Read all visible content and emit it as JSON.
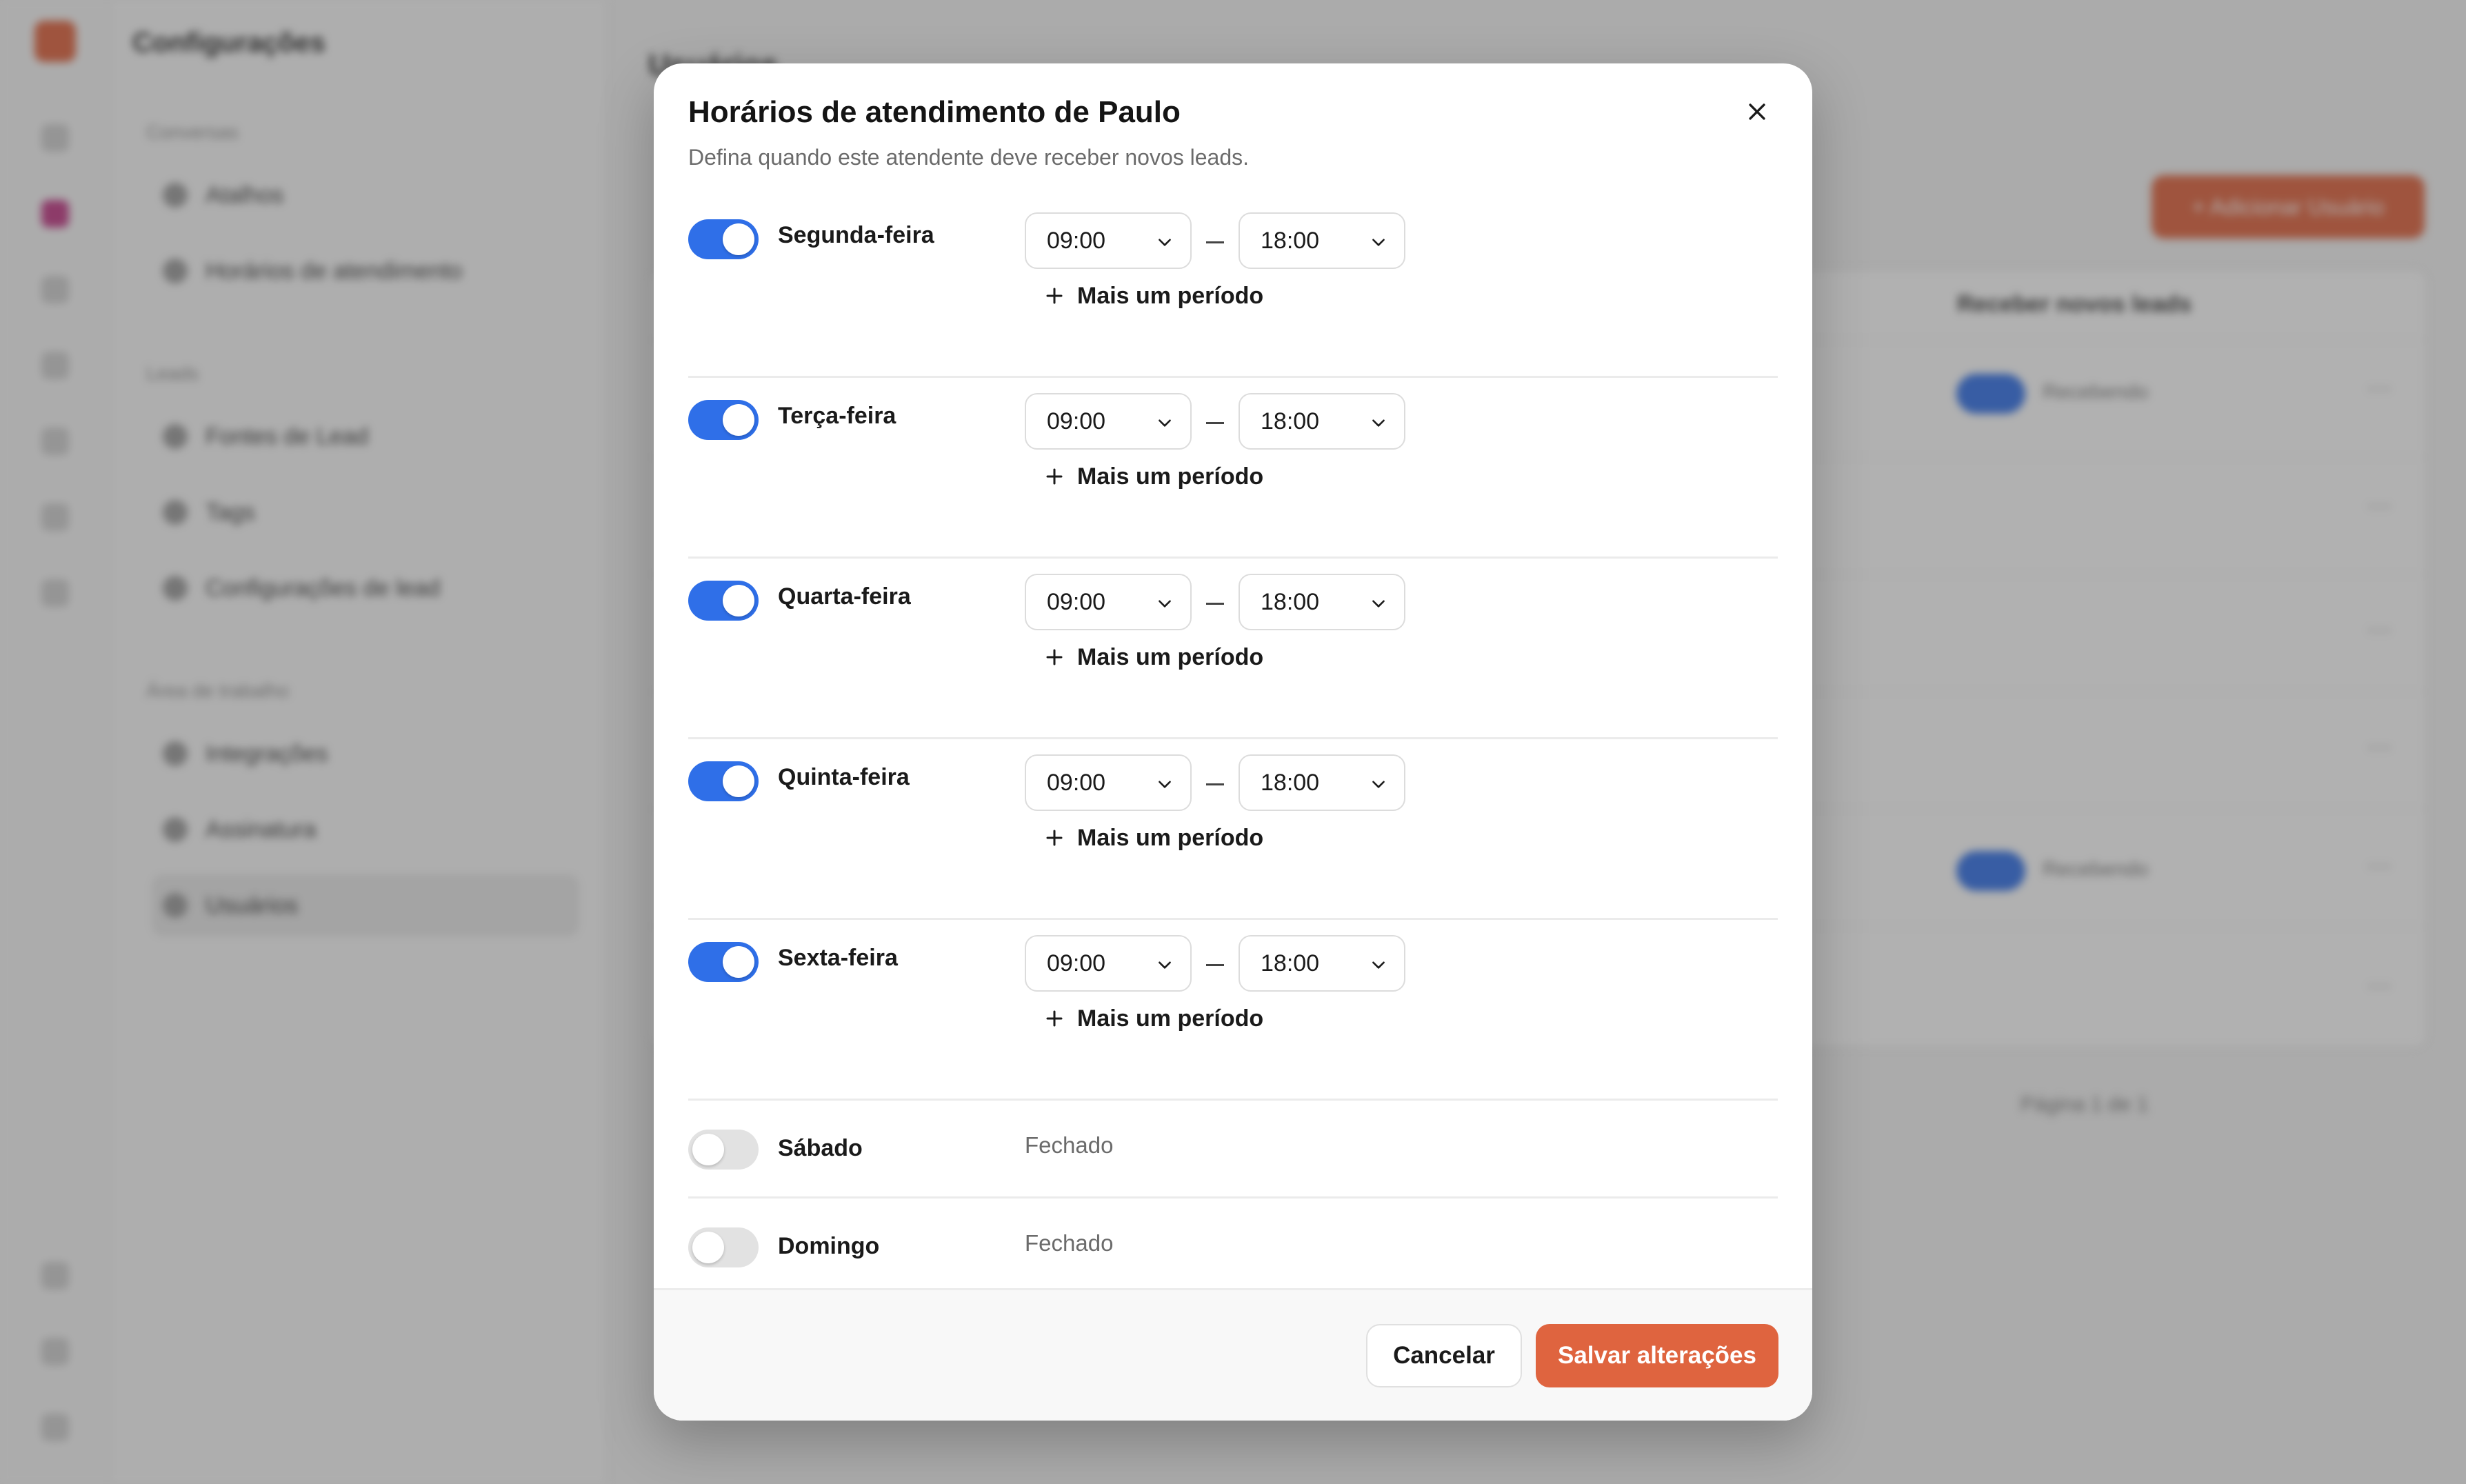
{
  "background": {
    "settings_title": "Configurações",
    "groups": [
      "Conversas",
      "Leads",
      "Área de trabalho"
    ],
    "nav_items": [
      "Atalhos",
      "Horários de atendimento",
      "Fontes de Lead",
      "Tags",
      "Configurações de lead",
      "Integrações",
      "Assinatura",
      "Usuários"
    ],
    "page_title": "Usuários",
    "add_user_label": "+ Adicionar Usuário",
    "column_header": "Receber novos leads",
    "receiving_label": "Recebendo",
    "pager_label": "Página 1 de 1"
  },
  "dialog": {
    "title": "Horários de atendimento de Paulo",
    "subtitle": "Defina quando este atendente deve receber novos leads.",
    "add_period_label": "Mais um período",
    "closed_label": "Fechado",
    "days": [
      {
        "name": "Segunda-feira",
        "enabled": true,
        "start": "09:00",
        "end": "18:00"
      },
      {
        "name": "Terça-feira",
        "enabled": true,
        "start": "09:00",
        "end": "18:00"
      },
      {
        "name": "Quarta-feira",
        "enabled": true,
        "start": "09:00",
        "end": "18:00"
      },
      {
        "name": "Quinta-feira",
        "enabled": true,
        "start": "09:00",
        "end": "18:00"
      },
      {
        "name": "Sexta-feira",
        "enabled": true,
        "start": "09:00",
        "end": "18:00"
      },
      {
        "name": "Sábado",
        "enabled": false
      },
      {
        "name": "Domingo",
        "enabled": false
      }
    ],
    "cancel_label": "Cancelar",
    "save_label": "Salvar alterações",
    "colors": {
      "toggle_on": "#2f6fe8",
      "toggle_off": "#e2e2e2",
      "primary": "#df643f"
    }
  }
}
